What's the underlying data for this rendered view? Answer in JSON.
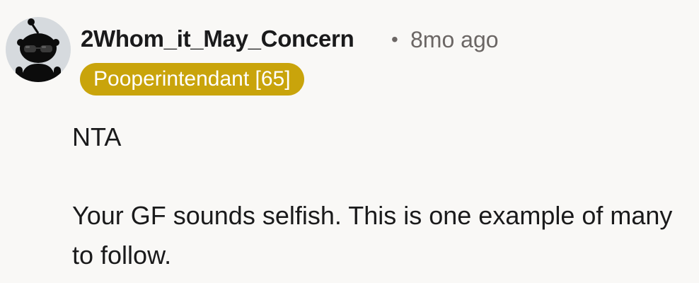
{
  "comment": {
    "author": "2Whom_it_May_Concern",
    "separator": "•",
    "timestamp": "8mo ago",
    "flair": "Pooperintendant [65]",
    "colors": {
      "flair_bg": "#c9a40b",
      "text": "#1a1a1b",
      "meta": "#6b6664",
      "background": "#f9f8f6"
    },
    "avatar_icon": "snoo-avatar-sunglasses-icon",
    "body": {
      "verdict": "NTA",
      "paragraph": "Your GF sounds selfish. This is one example of many to follow."
    }
  }
}
